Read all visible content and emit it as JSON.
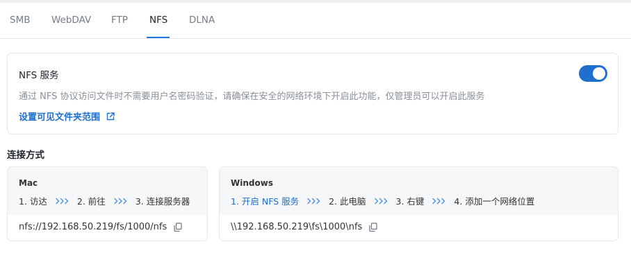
{
  "tabs": [
    {
      "label": "SMB",
      "active": false
    },
    {
      "label": "WebDAV",
      "active": false
    },
    {
      "label": "FTP",
      "active": false
    },
    {
      "label": "NFS",
      "active": true
    },
    {
      "label": "DLNA",
      "active": false
    }
  ],
  "service": {
    "title": "NFS 服务",
    "description": "通过 NFS 协议访问文件时不需要用户名密码验证，请确保在安全的网络环境下开启此功能，仅管理员可以开启此服务",
    "link_label": "设置可见文件夹范围",
    "link_icon": "external-link-icon",
    "enabled": true
  },
  "connection": {
    "title": "连接方式",
    "mac": {
      "name": "Mac",
      "steps": [
        "1. 访达",
        "2. 前往",
        "3. 连接服务器"
      ],
      "path": "nfs://192.168.50.219/fs/1000/nfs"
    },
    "windows": {
      "name": "Windows",
      "step1_prefix": "1. ",
      "step1_link": "开启 NFS 服务",
      "steps": [
        "2. 此电脑",
        "3. 右键",
        "4. 添加一个网络位置"
      ],
      "path": "\\\\192.168.50.219\\fs\\1000\\nfs"
    }
  },
  "colors": {
    "accent": "#1f6fce",
    "tab_indicator": "#1f7ae0",
    "muted_text": "#8a9099",
    "card_border": "#e6e8ec",
    "card_header_bg": "#f6f7f9"
  }
}
